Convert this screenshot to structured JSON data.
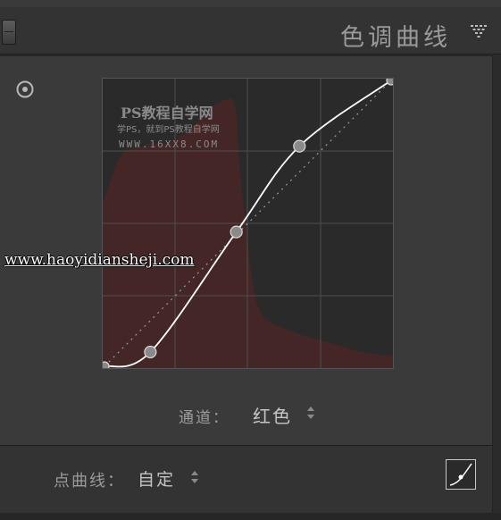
{
  "header": {
    "title": "色调曲线"
  },
  "watermarks": {
    "logo_line1": "PS教程自学网",
    "logo_line2": "学PS，就到PS教程自学网",
    "logo_line3": "WWW.16XX8.COM",
    "url": "www.haoyidiansheji.com"
  },
  "channel": {
    "label": "通道：",
    "value": "红色"
  },
  "point_curve": {
    "label": "点曲线：",
    "value": "自定"
  },
  "curve_points_normalized": [
    [
      0,
      0
    ],
    [
      0.16,
      0.05
    ],
    [
      0.46,
      0.47
    ],
    [
      0.68,
      0.77
    ],
    [
      1,
      1
    ]
  ],
  "colors": {
    "panel_bg": "#3a3a3a",
    "curve_bg": "#2a2a2a",
    "histogram_red": "#4a2626",
    "curve_line": "#ffffff",
    "control_point": "#8a8a8a"
  },
  "icons": {
    "menu": "menu-triangle-icon",
    "target": "target-adjustment-icon",
    "curve_edit": "curve-edit-icon",
    "up_down": "up-down-arrows-icon"
  }
}
